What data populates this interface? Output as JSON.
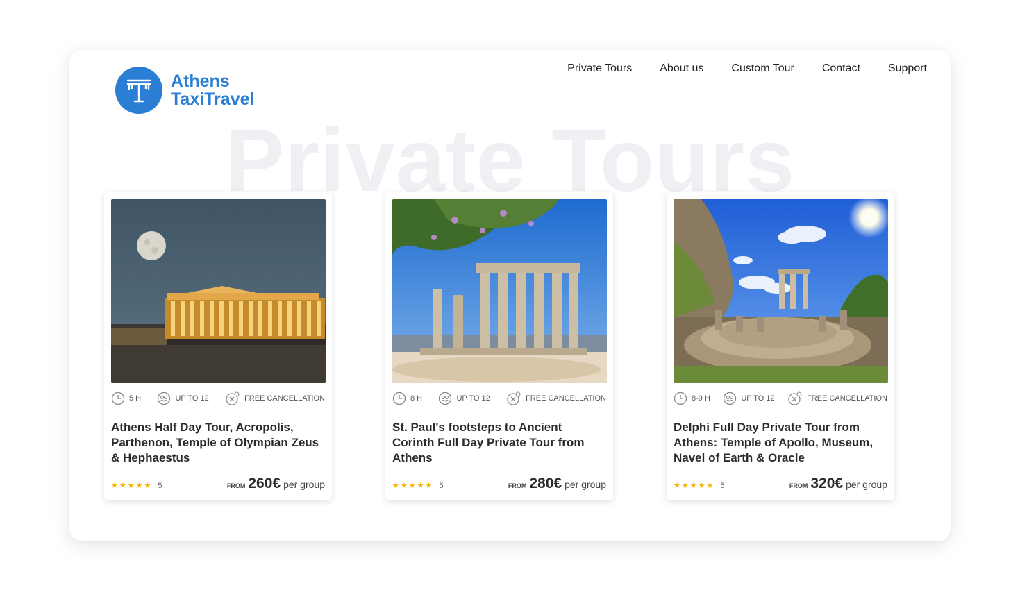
{
  "brand": {
    "line1": "Athens",
    "line2": "TaxiTravel",
    "color": "#2a7fd4"
  },
  "nav": [
    "Private Tours",
    "About us",
    "Custom Tour",
    "Contact",
    "Support"
  ],
  "watermark": "Private Tours",
  "cards": [
    {
      "image": "acropolis-parthenon-night-moon",
      "duration": "5 h",
      "group": "UP TO 12",
      "cancellation": "FREE CANCELLATION",
      "title": "Athens Half Day Tour, Acropolis, Parthenon, Temple of Olympian Zeus & Hephaestus",
      "rating": 5,
      "rating_label": "5",
      "price_prefix": "FROM",
      "price": "260€",
      "price_suffix": "per group"
    },
    {
      "image": "ancient-corinth-temple-of-apollo",
      "duration": "8 h",
      "group": "UP TO 12",
      "cancellation": "FREE CANCELLATION",
      "title": "St. Paul's footsteps to Ancient Corinth Full Day Private Tour from Athens",
      "rating": 5,
      "rating_label": "5",
      "price_prefix": "FROM",
      "price": "280€",
      "price_suffix": "per group"
    },
    {
      "image": "delphi-tholos-sunny-sky",
      "duration": "8-9 h",
      "group": "UP TO 12",
      "cancellation": "FREE CANCELLATION",
      "title": "Delphi Full Day Private Tour from Athens: Temple of Apollo, Museum, Navel of Earth & Oracle",
      "rating": 5,
      "rating_label": "5",
      "price_prefix": "FROM",
      "price": "320€",
      "price_suffix": "per group"
    }
  ]
}
